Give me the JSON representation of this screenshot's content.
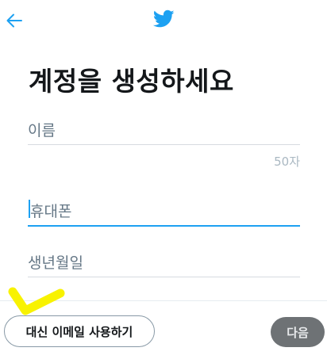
{
  "header": {
    "back_icon": "arrow-left-icon",
    "logo_icon": "twitter-bird-icon"
  },
  "colors": {
    "brand": "#1da1f2",
    "next_button_disabled": "#6e7275",
    "annotation": "#f8f200"
  },
  "main": {
    "title": "계정을 생성하세요",
    "name_field": {
      "placeholder": "이름",
      "value": "",
      "counter": "50자"
    },
    "phone_field": {
      "placeholder": "휴대폰",
      "value": "",
      "focused": true
    },
    "birthdate_field": {
      "placeholder": "생년월일",
      "value": ""
    }
  },
  "footer": {
    "use_email_label": "대신 이메일 사용하기",
    "next_label": "다음",
    "next_enabled": false
  }
}
